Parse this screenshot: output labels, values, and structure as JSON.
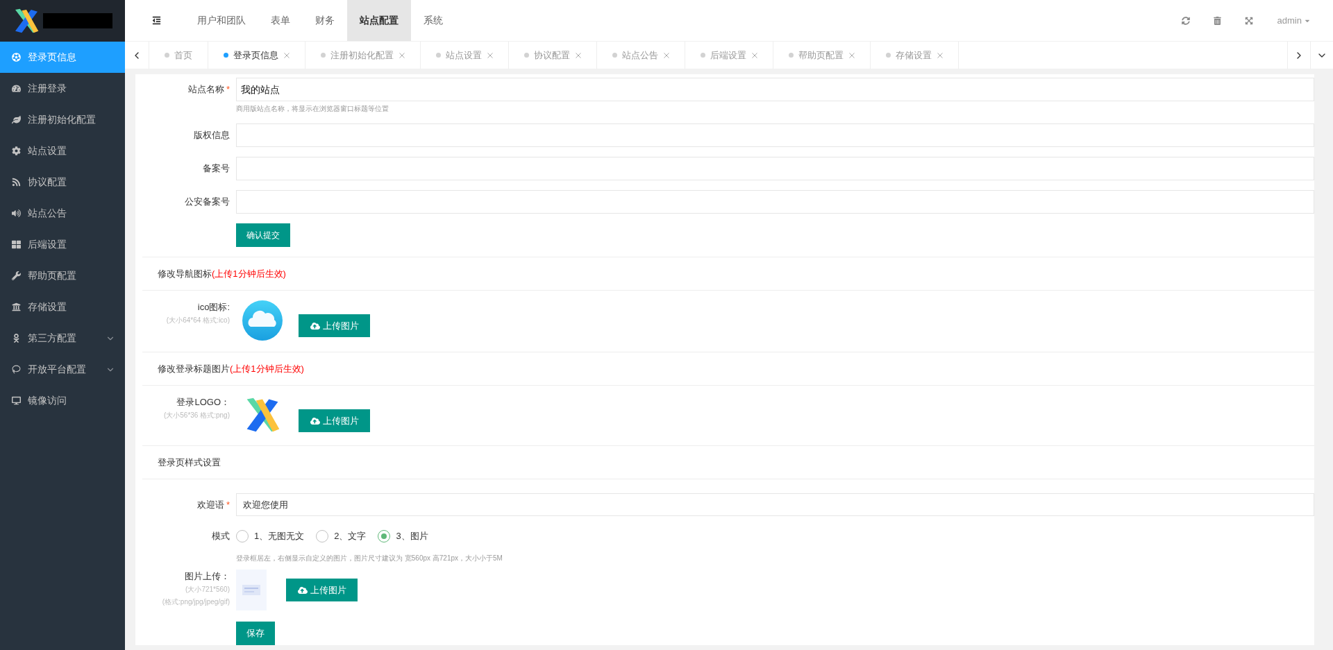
{
  "sidebar": {
    "items": [
      {
        "label": "登录页信息",
        "selected": true,
        "kind": "link"
      },
      {
        "label": "注册登录",
        "selected": false,
        "kind": "link"
      },
      {
        "label": "注册初始化配置",
        "selected": false,
        "kind": "link"
      },
      {
        "label": "站点设置",
        "selected": false,
        "kind": "link"
      },
      {
        "label": "协议配置",
        "selected": false,
        "kind": "link"
      },
      {
        "label": "站点公告",
        "selected": false,
        "kind": "link"
      },
      {
        "label": "后端设置",
        "selected": false,
        "kind": "link"
      },
      {
        "label": "帮助页配置",
        "selected": false,
        "kind": "link"
      },
      {
        "label": "存储设置",
        "selected": false,
        "kind": "link"
      },
      {
        "label": "第三方配置",
        "selected": false,
        "kind": "group"
      },
      {
        "label": "开放平台配置",
        "selected": false,
        "kind": "group"
      },
      {
        "label": "镜像访问",
        "selected": false,
        "kind": "link"
      }
    ]
  },
  "header": {
    "menu": [
      {
        "label": "用户和团队",
        "selected": false
      },
      {
        "label": "表单",
        "selected": false
      },
      {
        "label": "财务",
        "selected": false
      },
      {
        "label": "站点配置",
        "selected": true
      },
      {
        "label": "系统",
        "selected": false
      }
    ],
    "user": "admin"
  },
  "tabs": [
    {
      "label": "首页",
      "selected": false,
      "closable": false
    },
    {
      "label": "登录页信息",
      "selected": true,
      "closable": true
    },
    {
      "label": "注册初始化配置",
      "selected": false,
      "closable": true
    },
    {
      "label": "站点设置",
      "selected": false,
      "closable": true
    },
    {
      "label": "协议配置",
      "selected": false,
      "closable": true
    },
    {
      "label": "站点公告",
      "selected": false,
      "closable": true
    },
    {
      "label": "后端设置",
      "selected": false,
      "closable": true
    },
    {
      "label": "帮助页配置",
      "selected": false,
      "closable": true
    },
    {
      "label": "存储设置",
      "selected": false,
      "closable": true
    }
  ],
  "site_form": {
    "fields": [
      {
        "label": "站点名称",
        "required_mark": "*",
        "value": "我的站点",
        "hint": "商用版站点名称，将显示在浏览器窗口标题等位置"
      },
      {
        "label": "版权信息"
      },
      {
        "label": "备案号"
      },
      {
        "label": "公安备案号"
      }
    ],
    "submit_button": "确认提交"
  },
  "nav_icon_section": {
    "title": "修改导航图标",
    "note": "(上传1分钟后生效)",
    "label": "ico图标:",
    "size_hint": "(大小64*64 格式:ico)",
    "upload_button": "上传图片"
  },
  "login_logo_section": {
    "title": "修改登录标题图片",
    "note": "(上传1分钟后生效)",
    "label": "登录LOGO：",
    "size_hint": "(大小56*36 格式:png)",
    "upload_button": "上传图片"
  },
  "login_style_section": {
    "title": "登录页样式设置",
    "welcome": {
      "label": "欢迎语",
      "required_mark": "*",
      "value": "欢迎您使用"
    },
    "mode": {
      "label": "模式",
      "options": [
        {
          "label": "1、无图无文",
          "selected": false
        },
        {
          "label": "2、文字",
          "selected": false
        },
        {
          "label": "3、图片",
          "selected": true
        }
      ],
      "hint": "登录框居左，右侧显示自定义的图片，图片尺寸建议为 宽560px 高721px，大小小于5M"
    },
    "image_upload": {
      "label": "图片上传：",
      "size_hint": "(大小721*560)",
      "format_hint": "(格式:png/jpg/jpeg/gif)",
      "upload_button": "上传图片"
    },
    "save_button": "保存"
  }
}
